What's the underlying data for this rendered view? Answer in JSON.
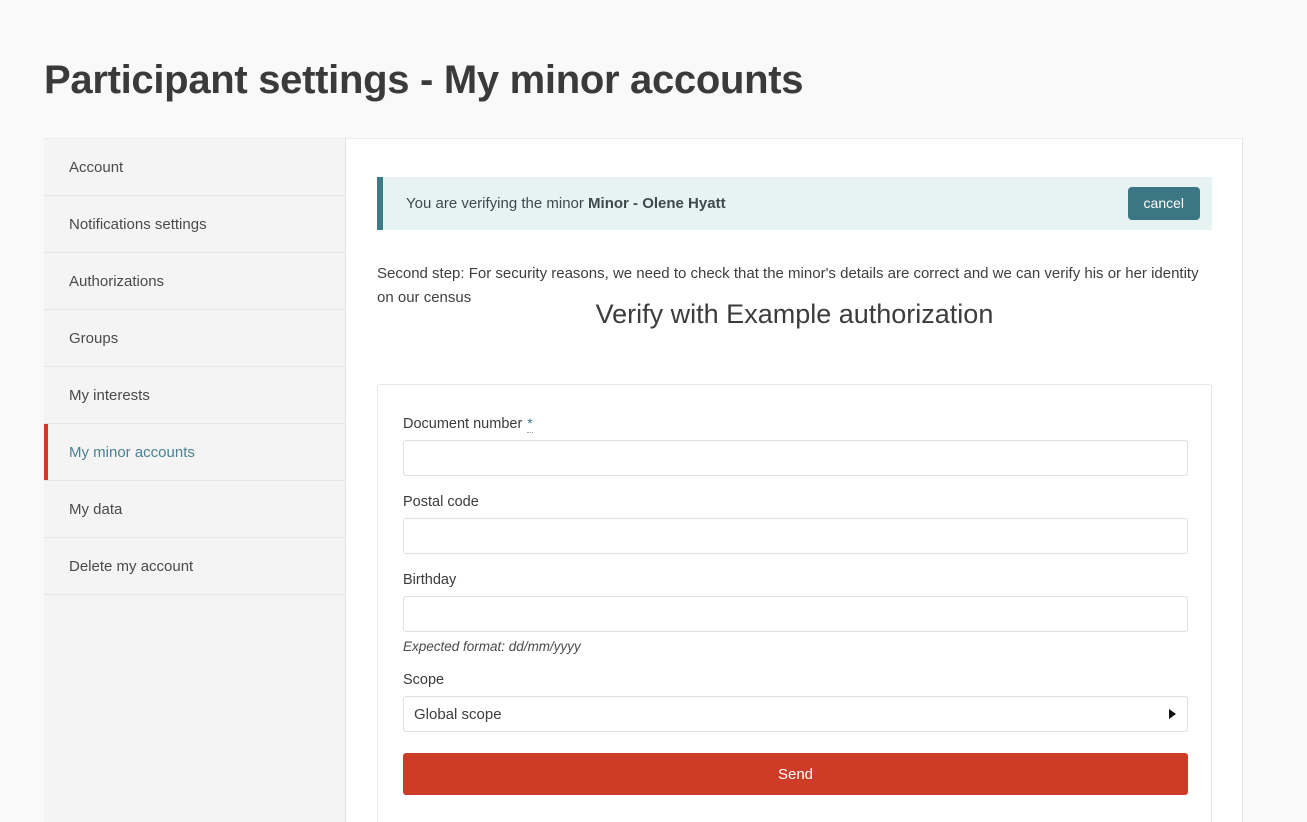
{
  "page": {
    "title": "Participant settings - My minor accounts"
  },
  "sidebar": {
    "items": [
      {
        "label": "Account",
        "active": false
      },
      {
        "label": "Notifications settings",
        "active": false
      },
      {
        "label": "Authorizations",
        "active": false
      },
      {
        "label": "Groups",
        "active": false
      },
      {
        "label": "My interests",
        "active": false
      },
      {
        "label": "My minor accounts",
        "active": true
      },
      {
        "label": "My data",
        "active": false
      },
      {
        "label": "Delete my account",
        "active": false
      }
    ],
    "active_accent_color": "#cf3c26",
    "active_text_color": "#4d8193"
  },
  "alert": {
    "message_prefix": "You are verifying the minor ",
    "minor_name": "Minor - Olene Hyatt",
    "cancel_label": "cancel",
    "background_color": "#e7f2f3",
    "border_color": "#3d7b87",
    "button_color": "#3b7685"
  },
  "main": {
    "intro_text": "Second step: For security reasons, we need to check that the minor's details are correct and we can verify his or her identity on our census",
    "section_heading": "Verify with Example authorization"
  },
  "form": {
    "fields": [
      {
        "label": "Document number",
        "required_marker": "*",
        "value": "",
        "placeholder": "",
        "hint": ""
      },
      {
        "label": "Postal code",
        "required_marker": "",
        "value": "",
        "placeholder": "",
        "hint": ""
      },
      {
        "label": "Birthday",
        "required_marker": "",
        "value": "",
        "placeholder": "",
        "hint": "Expected format: dd/mm/yyyy"
      }
    ],
    "scope": {
      "label": "Scope",
      "selected": "Global scope"
    },
    "submit_label": "Send",
    "submit_color": "#cd3c27"
  }
}
